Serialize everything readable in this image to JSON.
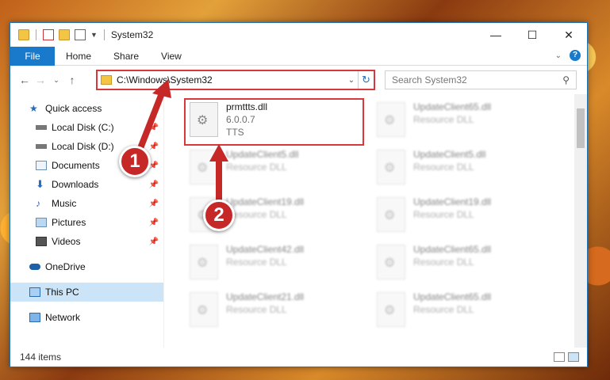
{
  "titlebar": {
    "title": "System32",
    "minimize": "—",
    "maximize": "☐",
    "close": "✕"
  },
  "ribbon": {
    "tabs": [
      "File",
      "Home",
      "Share",
      "View"
    ],
    "help": "?"
  },
  "address": {
    "path": "C:\\Windows\\System32",
    "refresh": "↻",
    "dropdown": "⌄"
  },
  "search": {
    "placeholder": "Search System32"
  },
  "nav": {
    "items": [
      {
        "label": "Quick access"
      },
      {
        "label": "Local Disk (C:)"
      },
      {
        "label": "Local Disk (D:)"
      },
      {
        "label": "Documents"
      },
      {
        "label": "Downloads"
      },
      {
        "label": "Music"
      },
      {
        "label": "Pictures"
      },
      {
        "label": "Videos"
      },
      {
        "label": "OneDrive"
      },
      {
        "label": "This PC"
      },
      {
        "label": "Network"
      }
    ]
  },
  "files": [
    {
      "name": "prmttts.dll",
      "line2": "6.0.0.7",
      "line3": "TTS"
    },
    {
      "name": "UpdateClient65.dll",
      "line2": "Resource DLL"
    },
    {
      "name": "UpdateClient5.dll",
      "line2": "Resource DLL"
    },
    {
      "name": "UpdateClient5.dll",
      "line2": "Resource DLL"
    },
    {
      "name": "UpdateClient19.dll",
      "line2": "Resource DLL"
    },
    {
      "name": "UpdateClient19.dll",
      "line2": "Resource DLL"
    },
    {
      "name": "UpdateClient42.dll",
      "line2": "Resource DLL"
    },
    {
      "name": "UpdateClient65.dll",
      "line2": "Resource DLL"
    },
    {
      "name": "UpdateClient21.dll",
      "line2": "Resource DLL"
    },
    {
      "name": "UpdateClient65.dll",
      "line2": "Resource DLL"
    }
  ],
  "status": {
    "count": "144 items"
  },
  "callouts": {
    "one": "1",
    "two": "2"
  },
  "colors": {
    "accent": "#1979ca",
    "highlight": "#d9383a",
    "callout": "#c62828"
  }
}
